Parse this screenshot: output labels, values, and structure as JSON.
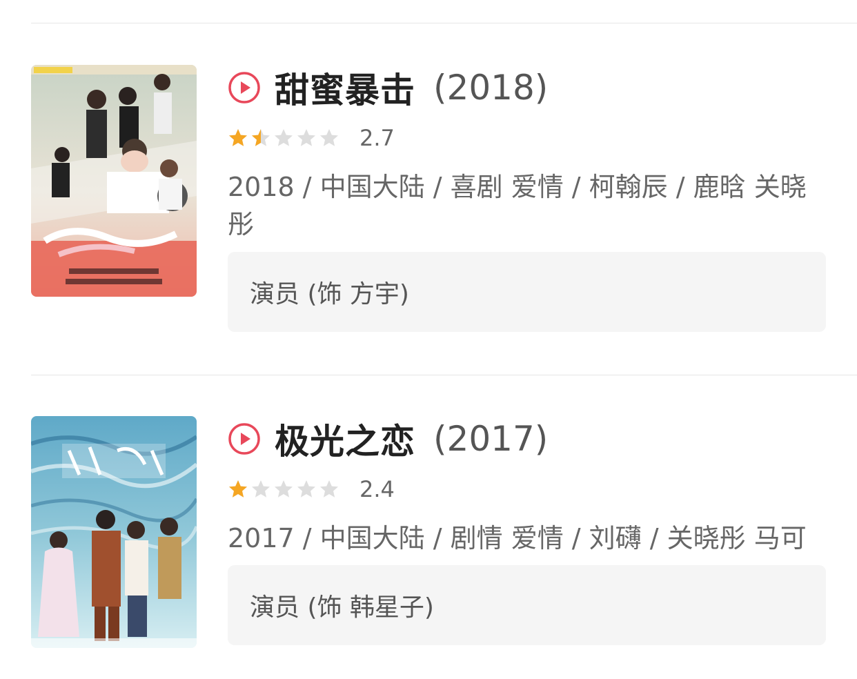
{
  "items": [
    {
      "title": "甜蜜暴击",
      "year": "(2018)",
      "rating": 2.7,
      "rating_label": "2.7",
      "meta": "2018 / 中国大陆 / 喜剧 爱情 / 柯翰辰 / 鹿晗 关晓彤",
      "role": "演员 (饰 方宇)",
      "poster_icon": "movie-poster-sweet-combat",
      "accent_color": "#e8485a"
    },
    {
      "title": "极光之恋",
      "year": "(2017)",
      "rating": 2.4,
      "rating_label": "2.4",
      "meta": "2017 / 中国大陆 / 剧情 爱情 / 刘礴 / 关晓彤 马可",
      "role": "演员 (饰 韩星子)",
      "poster_icon": "movie-poster-love-of-aurora",
      "accent_color": "#e8485a"
    }
  ],
  "colors": {
    "star_on": "#f5a623",
    "star_off": "#dddddd",
    "play_icon": "#e8485a"
  }
}
